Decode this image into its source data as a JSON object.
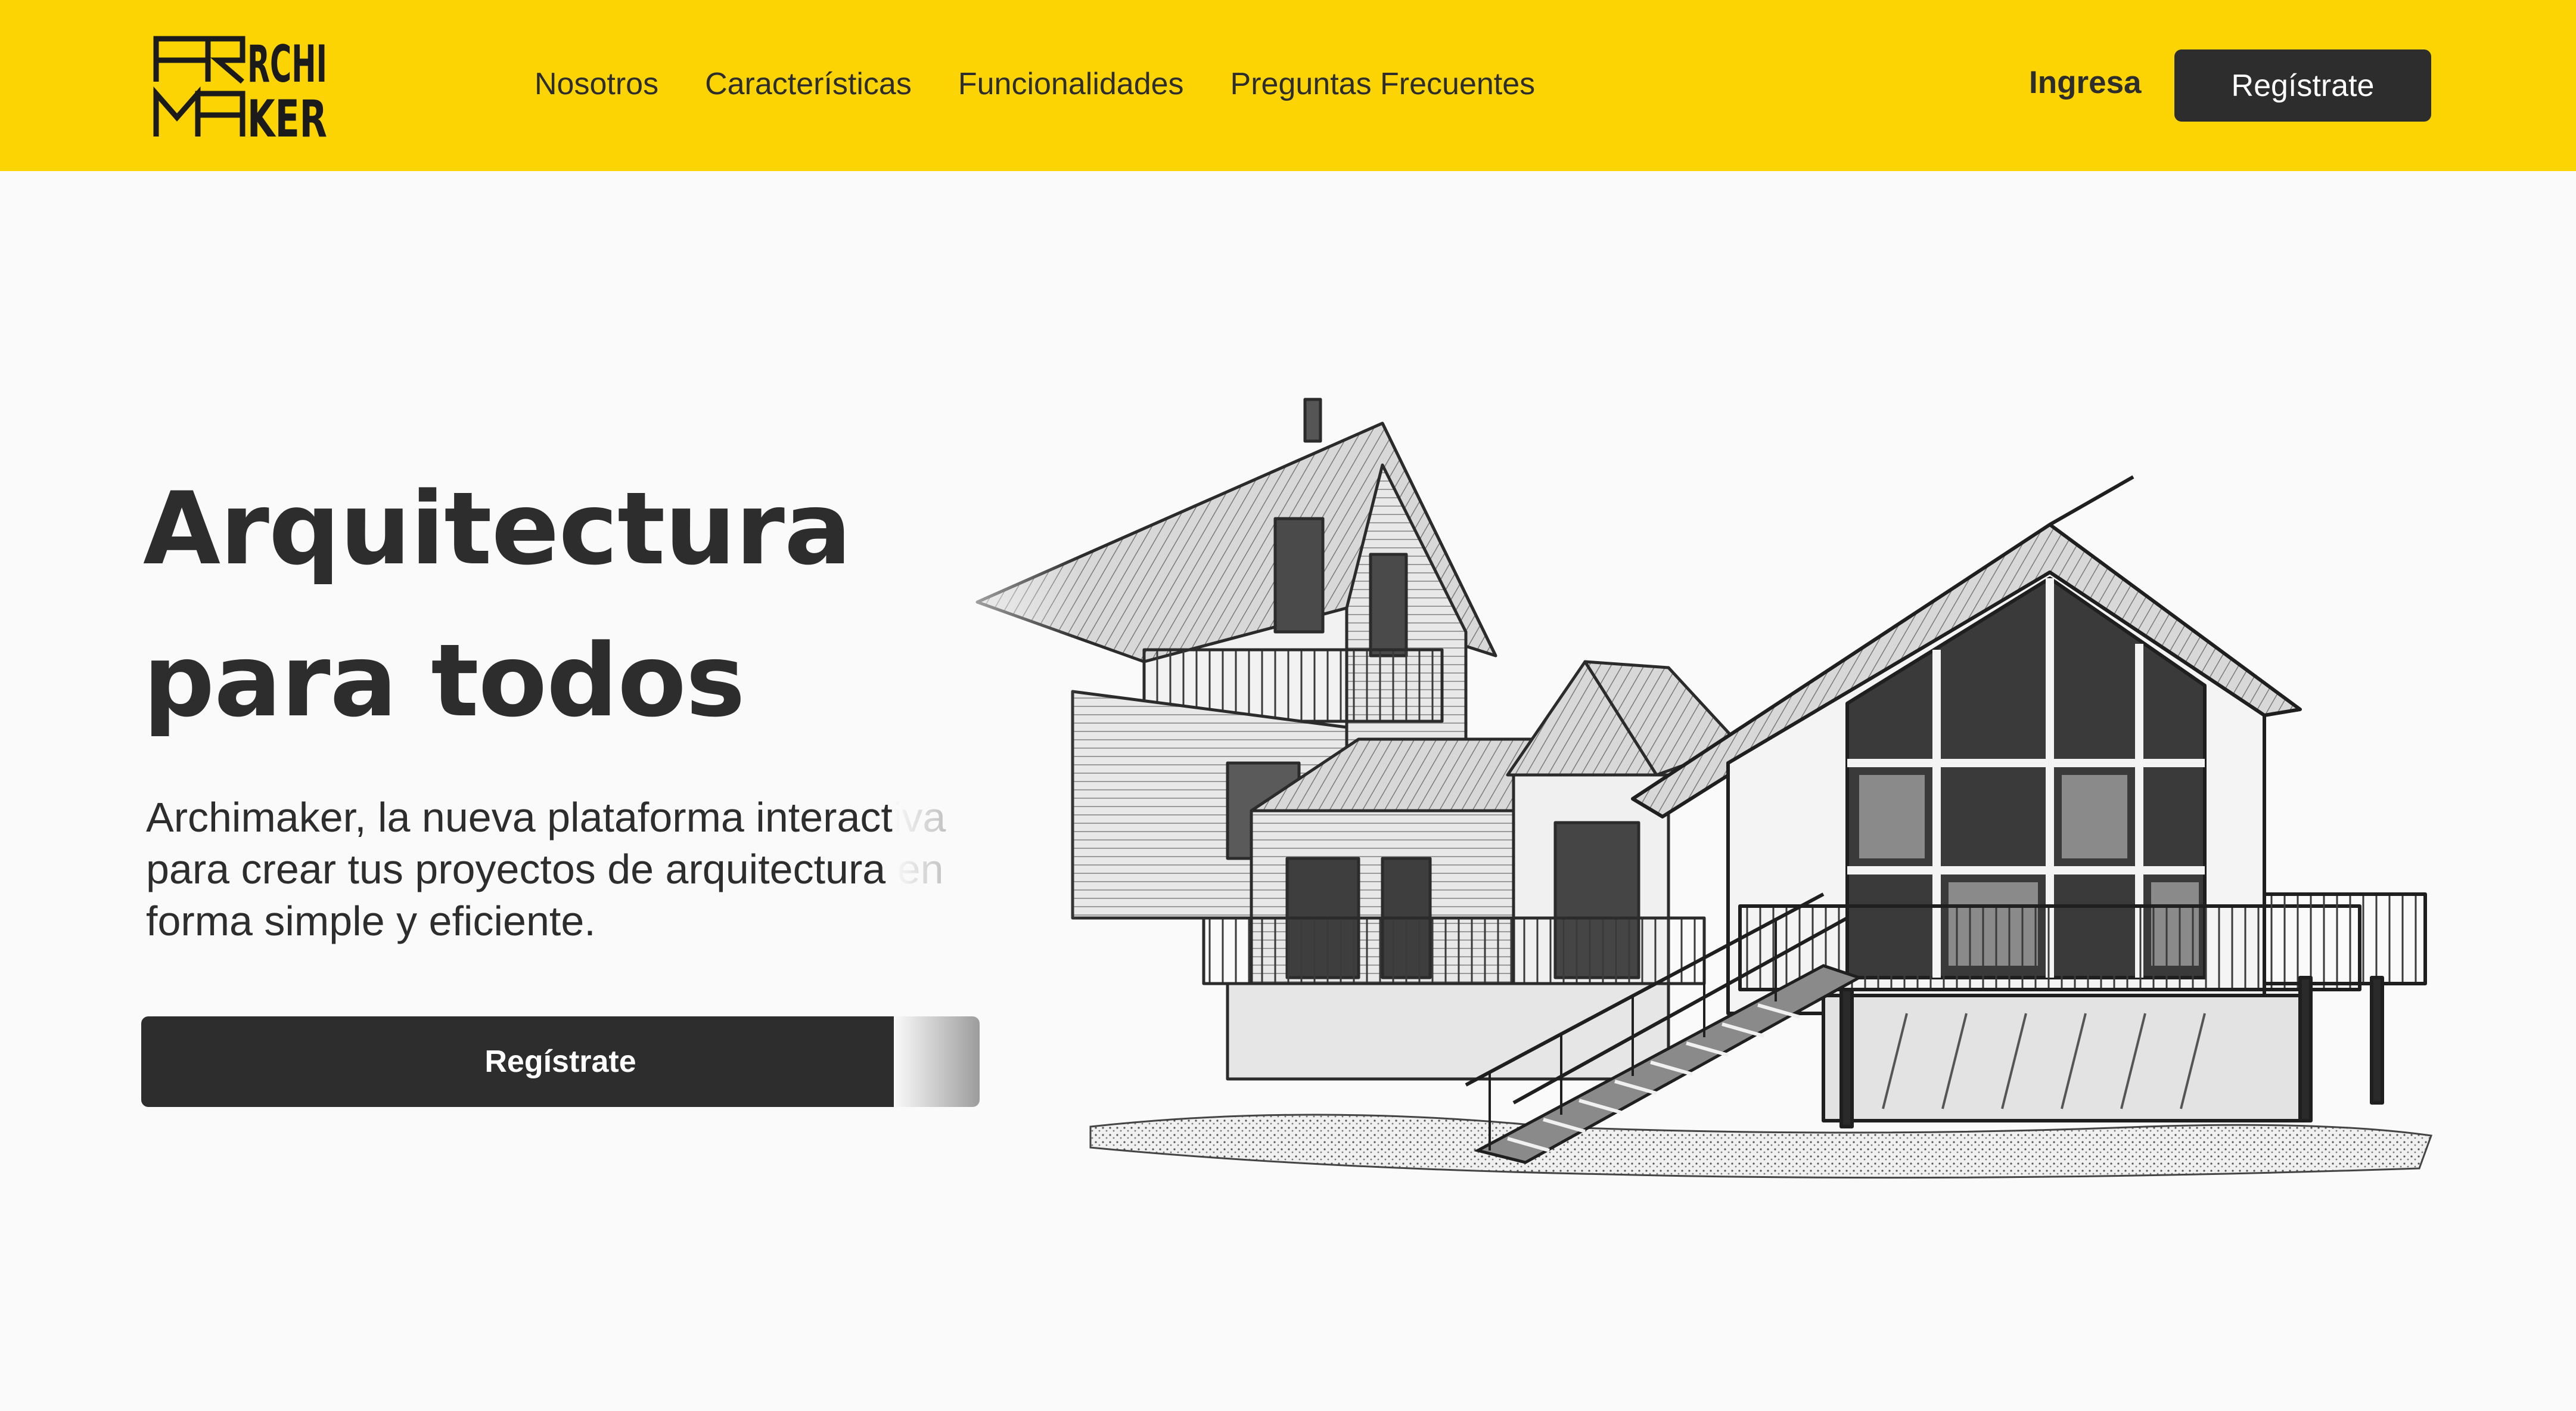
{
  "brand": {
    "logo_line1": "ARCHI",
    "logo_line2": "MAKER"
  },
  "header": {
    "nav": [
      {
        "label": "Nosotros"
      },
      {
        "label": "Características"
      },
      {
        "label": "Funcionalidades"
      },
      {
        "label": "Preguntas Frecuentes"
      }
    ],
    "login_label": "Ingresa",
    "register_label": "Regístrate"
  },
  "hero": {
    "title_line1": "Arquitectura",
    "title_line2": "para todos",
    "description": "Archimaker, la nueva plataforma interactiva para crear tus proyectos de arquitectura en forma simple y eficiente.",
    "cta_label": "Regístrate"
  },
  "colors": {
    "accent": "#fcd404",
    "dark": "#2d2d2d",
    "background": "#fafafa",
    "button_text": "#ffffff"
  }
}
